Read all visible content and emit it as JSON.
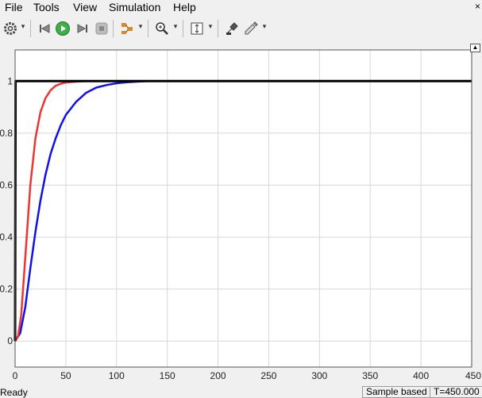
{
  "menu": {
    "file": "File",
    "tools": "Tools",
    "view": "View",
    "simulation": "Simulation",
    "help": "Help",
    "close_glyph": "×"
  },
  "toolbar": {
    "icons": [
      "gear-icon",
      "step-back-icon",
      "run-icon",
      "step-forward-icon",
      "stop-icon",
      "signal-selector-icon",
      "zoom-icon",
      "fit-axes-icon",
      "highlight-block-icon",
      "style-icon"
    ],
    "dropdown_glyph": "▾"
  },
  "status": {
    "left": "Ready",
    "mode": "Sample based",
    "time": "T=450.000"
  },
  "colors": {
    "plot_bg": "#ffffff",
    "grid": "#d8d8d8",
    "series_black": "#000000",
    "series_red": "#ee3333",
    "series_blue": "#1010ee"
  },
  "chart_data": {
    "type": "line",
    "xlim": [
      0,
      450
    ],
    "ylim": [
      -0.1,
      1.12
    ],
    "x_ticks": [
      0,
      50,
      100,
      150,
      200,
      250,
      300,
      350,
      400,
      450
    ],
    "y_ticks": [
      0,
      0.2,
      0.4,
      0.6,
      0.8,
      1
    ],
    "x_tick_labels": [
      "0",
      "50",
      "100",
      "150",
      "200",
      "250",
      "300",
      "350",
      "400",
      "450"
    ],
    "y_tick_labels": [
      "0",
      "0.2",
      "0.4",
      "0.6",
      "0.8",
      "1"
    ],
    "grid": true,
    "series": [
      {
        "color": "#000000",
        "x": [
          0,
          0.5,
          1,
          2,
          3,
          450
        ],
        "y": [
          0,
          1,
          1,
          1,
          1,
          1
        ]
      },
      {
        "color": "#ee3333",
        "x": [
          0,
          3,
          6,
          10,
          15,
          20,
          25,
          30,
          35,
          40,
          45,
          50,
          60,
          70,
          80,
          100,
          450
        ],
        "y": [
          0,
          0.02,
          0.1,
          0.32,
          0.6,
          0.78,
          0.88,
          0.935,
          0.965,
          0.982,
          0.99,
          0.995,
          0.998,
          1,
          1,
          1,
          1
        ]
      },
      {
        "color": "#1010ee",
        "x": [
          0,
          5,
          10,
          15,
          20,
          25,
          30,
          35,
          40,
          45,
          50,
          60,
          70,
          80,
          90,
          100,
          110,
          120,
          130,
          450
        ],
        "y": [
          0,
          0.03,
          0.13,
          0.28,
          0.42,
          0.54,
          0.64,
          0.72,
          0.78,
          0.83,
          0.87,
          0.92,
          0.955,
          0.975,
          0.985,
          0.992,
          0.996,
          0.998,
          1,
          1
        ]
      }
    ]
  }
}
